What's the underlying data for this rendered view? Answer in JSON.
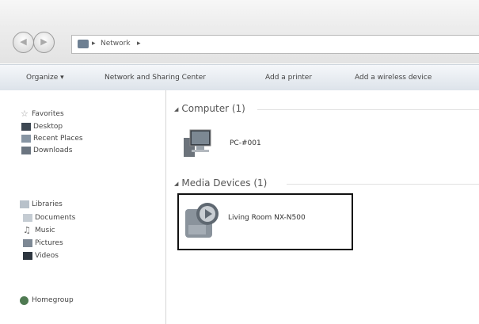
{
  "address": {
    "crumbs": [
      "Network"
    ],
    "separators": [
      "▸",
      "▸"
    ]
  },
  "toolbar": {
    "organize": "Organize ▾",
    "network_center": "Network and Sharing Center",
    "add_printer": "Add a printer",
    "add_wireless": "Add a wireless device"
  },
  "nav": {
    "favorites": {
      "label": "Favorites",
      "items": [
        "Desktop",
        "Recent Places",
        "Downloads"
      ]
    },
    "libraries": {
      "label": "Libraries",
      "items": [
        "Documents",
        "Music",
        "Pictures",
        "Videos"
      ]
    },
    "homegroup": "Homegroup"
  },
  "content": {
    "computer_group": "Computer (1)",
    "computer_item": "PC-#001",
    "media_group": "Media Devices (1)",
    "media_item": "Living Room NX-N500"
  }
}
